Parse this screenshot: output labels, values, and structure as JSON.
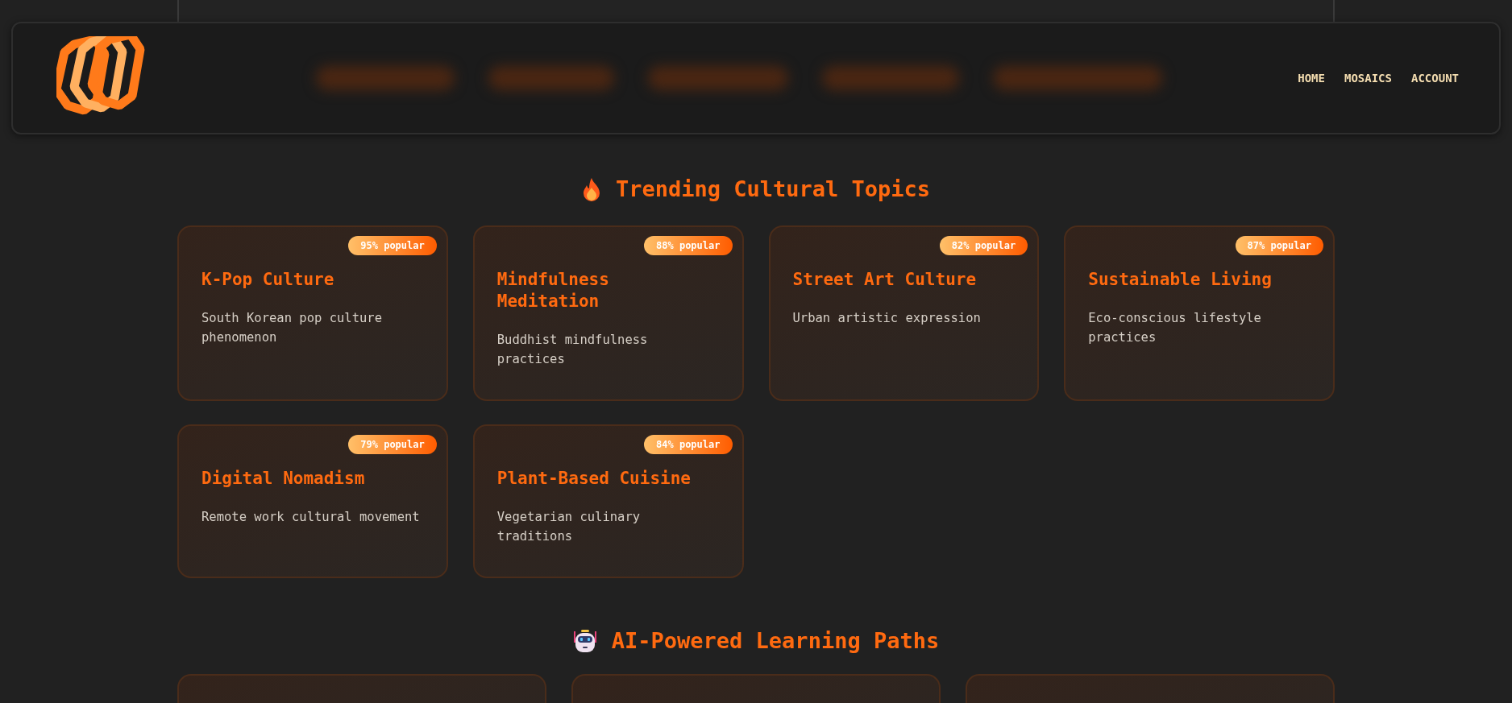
{
  "header": {
    "nav": [
      {
        "label": "HOME"
      },
      {
        "label": "MOSAICS"
      },
      {
        "label": "ACCOUNT"
      }
    ]
  },
  "trending": {
    "title": "Trending Cultural Topics",
    "cards": [
      {
        "title": "K-Pop Culture",
        "description": "South Korean pop culture phenomenon",
        "badge": "95% popular"
      },
      {
        "title": "Mindfulness Meditation",
        "description": "Buddhist mindfulness practices",
        "badge": "88% popular"
      },
      {
        "title": "Street Art Culture",
        "description": "Urban artistic expression",
        "badge": "82% popular"
      },
      {
        "title": "Sustainable Living",
        "description": "Eco-conscious lifestyle practices",
        "badge": "87% popular"
      },
      {
        "title": "Digital Nomadism",
        "description": "Remote work cultural movement",
        "badge": "79% popular"
      },
      {
        "title": "Plant-Based Cuisine",
        "description": "Vegetarian culinary traditions",
        "badge": "84% popular"
      }
    ]
  },
  "learning_paths": {
    "title": "AI-Powered Learning Paths",
    "cards": [
      {
        "kind": "card"
      },
      {
        "kind": "card"
      },
      {
        "kind": "card"
      }
    ]
  }
}
